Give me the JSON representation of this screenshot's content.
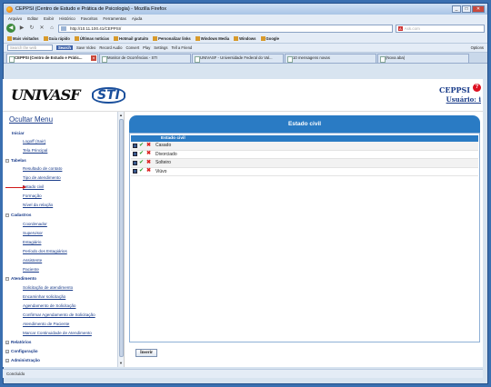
{
  "window": {
    "title": "CEPPSI (Centro de Estudo e Prática de Psicologia) - Mozilla Firefox"
  },
  "menubar": [
    "Arquivo",
    "Editar",
    "Exibir",
    "Histórico",
    "Favoritos",
    "Ferramentas",
    "Ajuda"
  ],
  "nav": {
    "url": "http://10.11.100.41/CEPPSI/",
    "search_placeholder": "Ask.com",
    "search_engine": "A"
  },
  "bookmarks": [
    "Mais visitados",
    "Guia rápido",
    "Últimas notícias",
    "Hotmail gratuito",
    "Personalizar links",
    "Windows Media",
    "Windows",
    "Google"
  ],
  "toolbar": {
    "search_placeholder": "Search the web",
    "search_btn": "Search",
    "items": [
      "Save Video",
      "Record Audio",
      "Convert",
      "Play",
      "Settings",
      "Tell a Friend"
    ],
    "options": "Options"
  },
  "tabs": [
    {
      "label": "CEPPSI (Centro de Estudo e Prátic...",
      "active": true
    },
    {
      "label": "Monitor de Ocorrências - STI",
      "active": false
    },
    {
      "label": "UNIVASF - Universidade Federal do Val...",
      "active": false
    },
    {
      "label": "10 mensagens novas",
      "active": false
    },
    {
      "label": "(Nova aba)",
      "active": false
    }
  ],
  "header": {
    "logo1": "UNIVASF",
    "logo2": "STI",
    "app": "CEPPSI",
    "user_label": "Usuário: i"
  },
  "sidebar": {
    "toggle": "Ocultar Menu",
    "sections": [
      {
        "title": "Iniciar",
        "items": [
          "Logoff (Sair)",
          "Tela Principal"
        ]
      },
      {
        "title": "Tabelas",
        "items": [
          "Resultado de contato",
          "Tipo de atendimento",
          "Estado civil",
          "Formação",
          "Nível da relação"
        ]
      },
      {
        "title": "Cadastros",
        "items": [
          "Coordenador",
          "Supervisor",
          "Estagiário",
          "Período dos Estagiários",
          "Assistente",
          "Paciente"
        ]
      },
      {
        "title": "Atendimento",
        "items": [
          "Solicitação de atendimento",
          "Encaminhar solicitação",
          "Agendamento de Solicitação",
          "Confirmar Agendamento de Solicitação",
          "Atendimento de Paciente",
          "Marcar Continuidade de Atendimento"
        ]
      },
      {
        "title": "Relatórios",
        "items": []
      },
      {
        "title": "Configuração",
        "items": []
      },
      {
        "title": "Administração",
        "items": []
      }
    ]
  },
  "main": {
    "title": "Estado civil",
    "column_header": "Estado civil",
    "rows": [
      "Casado",
      "Divorciado",
      "Solteiro",
      "Viúvo"
    ],
    "insert_button": "Inserir"
  },
  "status": "Concluído"
}
